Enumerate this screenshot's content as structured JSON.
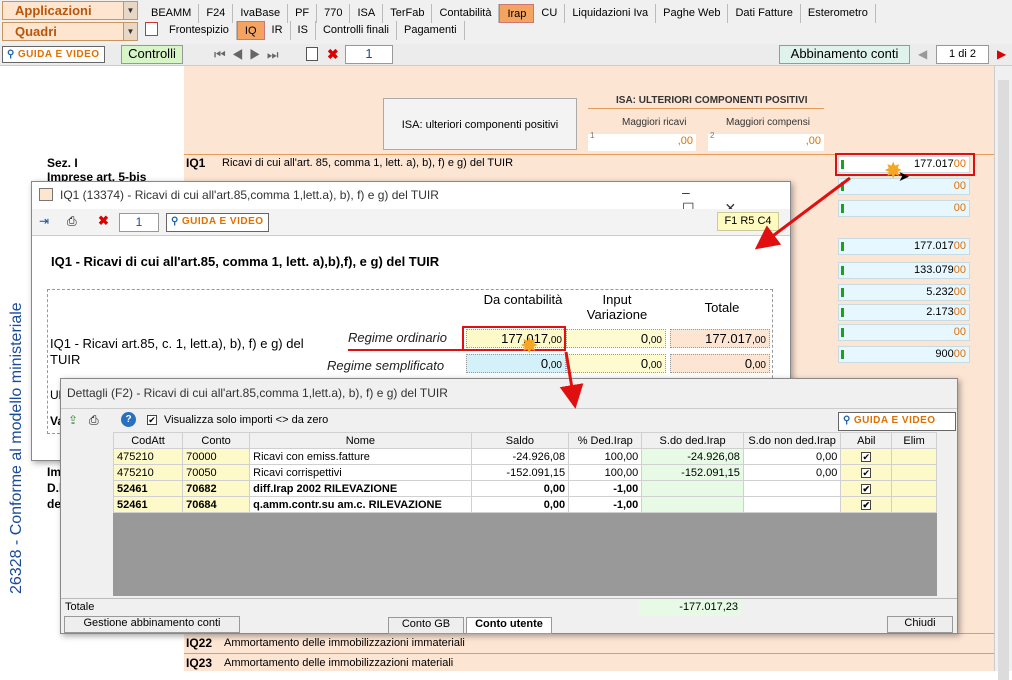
{
  "topbar": {
    "applicazioni": "Applicazioni",
    "quadri": "Quadri",
    "tabs": [
      "BEAMM",
      "F24",
      "IvaBase",
      "PF",
      "770",
      "ISA",
      "TerFab",
      "Contabilità",
      "Irap",
      "CU",
      "Liquidazioni Iva",
      "Paghe Web",
      "Dati Fatture",
      "Esterometro"
    ],
    "subtabs": [
      "Frontespizio",
      "IQ",
      "IR",
      "IS",
      "Controlli finali",
      "Pagamenti"
    ]
  },
  "toolbar": {
    "guida": "GUIDA E VIDEO",
    "controlli": "Controlli",
    "page": "1",
    "abbinamento": "Abbinamento conti",
    "pageinfo": "1 di 2"
  },
  "side": {
    "vertical": "26328 - Conforme al modello ministeriale",
    "sez": "Sez. I",
    "imprese": "Imprese art. 5-bis",
    "im": "Im",
    "dl": "D.l",
    "de": "de"
  },
  "form": {
    "isa_button": "ISA: ulteriori componenti positivi",
    "isa_header": "ISA: ULTERIORI COMPONENTI POSITIVI",
    "maggiori_ricavi": "Maggiori ricavi",
    "maggiori_compensi": "Maggiori compensi",
    "n1": "1",
    "n2": "2",
    "zero": ",00",
    "iq1_code": "IQ1",
    "iq1_desc": "Ricavi di cui all'art. 85, comma 1, lett. a), b), f) e g) del TUIR",
    "iq22_code": "IQ22",
    "iq22_desc": "Ammortamento delle immobilizzazioni immateriali",
    "iq23_code": "IQ23",
    "iq23_desc": "Ammortamento delle immobilizzazioni materiali",
    "right_values": [
      "177.017",
      "",
      "",
      "177.017",
      "133.079",
      "5.232",
      "2.173",
      "",
      "900"
    ],
    "dec": "00"
  },
  "win1": {
    "title": "IQ1 (13374) - Ricavi di cui all'art.85,comma 1,lett.a), b), f) e g) del TUIR",
    "page": "1",
    "guida": "GUIDA E VIDEO",
    "ref": "F1 R5 C4",
    "heading": "IQ1 - Ricavi di cui all'art.85, comma 1, lett. a),b),f), e g) del TUIR",
    "col1": "Da contabilità",
    "col2": "Input Variazione",
    "col3": "Totale",
    "rowlabel": "IQ1  - Ricavi art.85, c. 1, lett.a), b), f) e g) del TUIR",
    "reg_ord": "Regime ordinario",
    "reg_sempl": "Regime semplificato",
    "ord": [
      "177.017",
      "0",
      "177.017"
    ],
    "sem": [
      "0",
      "0",
      "0"
    ],
    "dec": ",00",
    "ul": "Ul",
    "va": "Va"
  },
  "win2": {
    "title": "Dettagli (F2) - Ricavi di cui all'art.85,comma 1,lett.a), b), f) e g) del TUIR",
    "filter": "Visualizza solo importi <> da zero",
    "guida": "GUIDA E VIDEO",
    "headers": [
      "CodAtt",
      "Conto",
      "Nome",
      "Saldo",
      "% Ded.Irap",
      "S.do ded.Irap",
      "S.do non ded.Irap",
      "Abil",
      "Elim"
    ],
    "rows": [
      [
        "475210",
        "70000",
        "Ricavi con emiss.fatture",
        "-24.926,08",
        "100,00",
        "-24.926,08",
        "0,00"
      ],
      [
        "475210",
        "70050",
        "Ricavi corrispettivi",
        "-152.091,15",
        "100,00",
        "-152.091,15",
        "0,00"
      ],
      [
        "52461",
        "70682",
        "diff.Irap 2002        RILEVAZIONE",
        "0,00",
        "-1,00",
        "",
        ""
      ],
      [
        "52461",
        "70684",
        "q.amm.contr.su am.c. RILEVAZIONE",
        "0,00",
        "-1,00",
        "",
        ""
      ]
    ],
    "totale": "Totale",
    "totale_val": "-177.017,23",
    "gestione": "Gestione abbinamento conti",
    "conto_gb": "Conto GB",
    "conto_utente": "Conto utente",
    "chiudi": "Chiudi"
  },
  "colors": {
    "accent": "#e07000",
    "tab_active": "#f4a460",
    "red": "#e01010"
  }
}
